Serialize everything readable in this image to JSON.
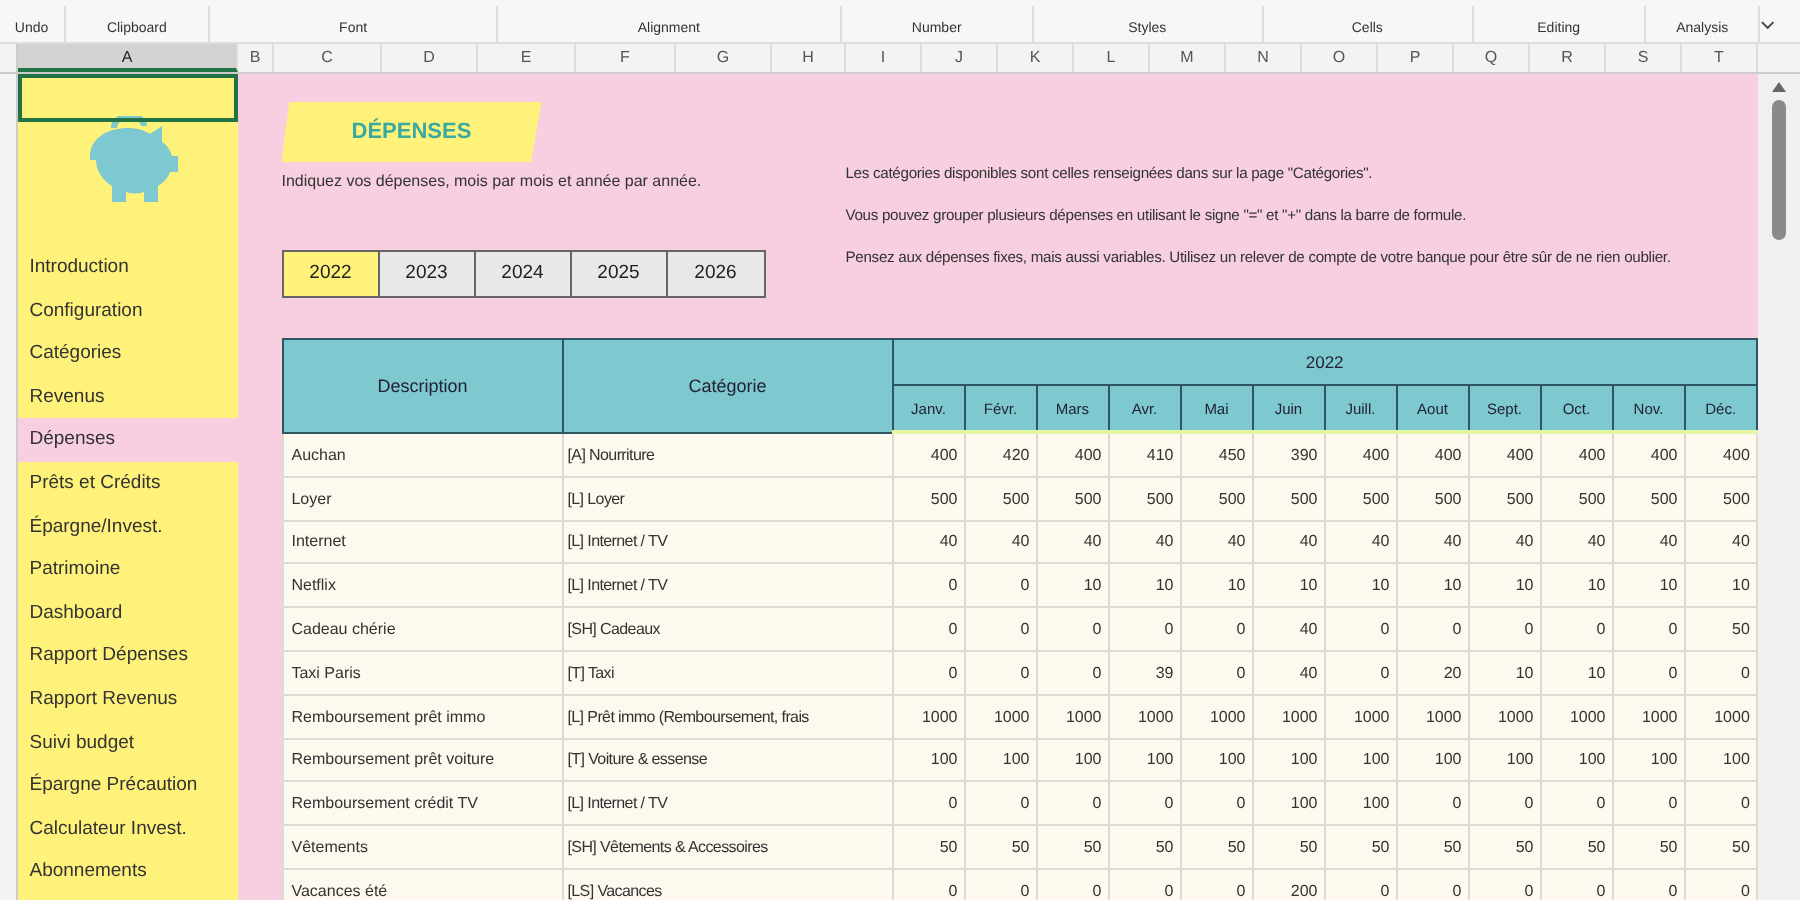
{
  "ribbon": {
    "groups": [
      "Undo",
      "Clipboard",
      "Font",
      "Alignment",
      "Number",
      "Styles",
      "Cells",
      "Editing",
      "Analysis"
    ]
  },
  "column_headers": [
    {
      "label": "A",
      "selected": true
    },
    {
      "label": "B",
      "selected": false
    },
    {
      "label": "C",
      "selected": false
    },
    {
      "label": "D",
      "selected": false
    },
    {
      "label": "E",
      "selected": false
    },
    {
      "label": "F",
      "selected": false
    },
    {
      "label": "G",
      "selected": false
    },
    {
      "label": "H",
      "selected": false
    },
    {
      "label": "I",
      "selected": false
    },
    {
      "label": "J",
      "selected": false
    },
    {
      "label": "K",
      "selected": false
    },
    {
      "label": "L",
      "selected": false
    },
    {
      "label": "M",
      "selected": false
    },
    {
      "label": "N",
      "selected": false
    },
    {
      "label": "O",
      "selected": false
    },
    {
      "label": "P",
      "selected": false
    },
    {
      "label": "Q",
      "selected": false
    },
    {
      "label": "R",
      "selected": false
    },
    {
      "label": "S",
      "selected": false
    },
    {
      "label": "T",
      "selected": false
    }
  ],
  "sidebar": {
    "items": [
      {
        "label": "Introduction",
        "selected": false
      },
      {
        "label": "Configuration",
        "selected": false
      },
      {
        "label": "Catégories",
        "selected": false
      },
      {
        "label": "Revenus",
        "selected": false
      },
      {
        "label": "Dépenses",
        "selected": true
      },
      {
        "label": "Prêts et Crédits",
        "selected": false
      },
      {
        "label": "Épargne/Invest.",
        "selected": false
      },
      {
        "label": "Patrimoine",
        "selected": false
      },
      {
        "label": "Dashboard",
        "selected": false
      },
      {
        "label": "Rapport Dépenses",
        "selected": false
      },
      {
        "label": "Rapport Revenus",
        "selected": false
      },
      {
        "label": "Suivi budget",
        "selected": false
      },
      {
        "label": "Épargne Précaution",
        "selected": false
      },
      {
        "label": "Calculateur Invest.",
        "selected": false
      },
      {
        "label": "Abonnements",
        "selected": false
      }
    ]
  },
  "title": "DÉPENSES",
  "intro": "Indiquez vos dépenses, mois par mois et année par année.",
  "notes": [
    "Les catégories disponibles sont celles renseignées dans sur la page \"Catégories\".",
    "Vous pouvez grouper plusieurs dépenses en utilisant le signe \"=\" et \"+\" dans la barre de formule.",
    "Pensez aux dépenses fixes, mais aussi variables. Utilisez un relever de compte de votre banque pour être sûr de ne rien oublier."
  ],
  "years": [
    {
      "label": "2022",
      "selected": true
    },
    {
      "label": "2023",
      "selected": false
    },
    {
      "label": "2024",
      "selected": false
    },
    {
      "label": "2025",
      "selected": false
    },
    {
      "label": "2026",
      "selected": false
    }
  ],
  "table": {
    "description_header": "Description",
    "category_header": "Catégorie",
    "year_header": "2022",
    "months": [
      "Janv.",
      "Févr.",
      "Mars",
      "Avr.",
      "Mai",
      "Juin",
      "Juill.",
      "Aout",
      "Sept.",
      "Oct.",
      "Nov.",
      "Déc."
    ],
    "rows": [
      {
        "description": "Auchan",
        "category": "[A] Nourriture",
        "values": [
          "400",
          "420",
          "400",
          "410",
          "450",
          "390",
          "400",
          "400",
          "400",
          "400",
          "400",
          "400"
        ]
      },
      {
        "description": "Loyer",
        "category": "[L] Loyer",
        "values": [
          "500",
          "500",
          "500",
          "500",
          "500",
          "500",
          "500",
          "500",
          "500",
          "500",
          "500",
          "500"
        ]
      },
      {
        "description": "Internet",
        "category": "[L] Internet / TV",
        "values": [
          "40",
          "40",
          "40",
          "40",
          "40",
          "40",
          "40",
          "40",
          "40",
          "40",
          "40",
          "40"
        ]
      },
      {
        "description": "Netflix",
        "category": "[L] Internet / TV",
        "values": [
          "0",
          "0",
          "10",
          "10",
          "10",
          "10",
          "10",
          "10",
          "10",
          "10",
          "10",
          "10"
        ]
      },
      {
        "description": "Cadeau chérie",
        "category": "[SH] Cadeaux",
        "values": [
          "0",
          "0",
          "0",
          "0",
          "0",
          "40",
          "0",
          "0",
          "0",
          "0",
          "0",
          "50"
        ]
      },
      {
        "description": "Taxi Paris",
        "category": "[T] Taxi",
        "values": [
          "0",
          "0",
          "0",
          "39",
          "0",
          "40",
          "0",
          "20",
          "10",
          "10",
          "0",
          "0"
        ]
      },
      {
        "description": "Remboursement prêt immo",
        "category": "[L] Prêt immo (Remboursement, frais",
        "values": [
          "1000",
          "1000",
          "1000",
          "1000",
          "1000",
          "1000",
          "1000",
          "1000",
          "1000",
          "1000",
          "1000",
          "1000"
        ]
      },
      {
        "description": "Remboursement prêt voiture",
        "category": "[T] Voiture & essense",
        "values": [
          "100",
          "100",
          "100",
          "100",
          "100",
          "100",
          "100",
          "100",
          "100",
          "100",
          "100",
          "100"
        ]
      },
      {
        "description": "Remboursement crédit TV",
        "category": "[L] Internet / TV",
        "values": [
          "0",
          "0",
          "0",
          "0",
          "0",
          "100",
          "100",
          "0",
          "0",
          "0",
          "0",
          "0"
        ]
      },
      {
        "description": "Vêtements",
        "category": "[SH] Vêtements & Accessoires",
        "values": [
          "50",
          "50",
          "50",
          "50",
          "50",
          "50",
          "50",
          "50",
          "50",
          "50",
          "50",
          "50"
        ]
      },
      {
        "description": "Vacances été",
        "category": "[LS] Vacances",
        "values": [
          "0",
          "0",
          "0",
          "0",
          "0",
          "200",
          "0",
          "0",
          "0",
          "0",
          "0",
          "0"
        ]
      }
    ]
  }
}
